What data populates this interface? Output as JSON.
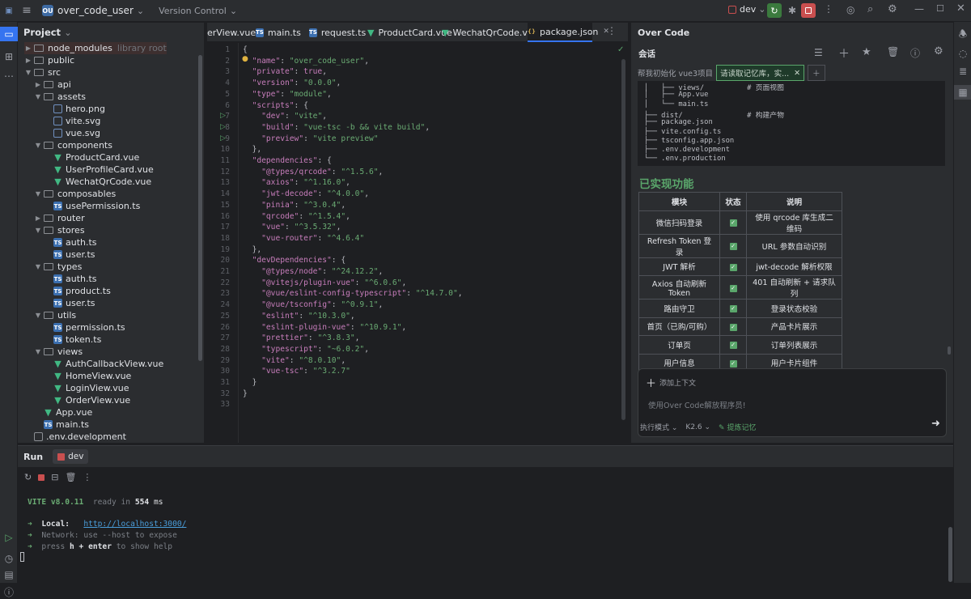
{
  "titlebar": {
    "project_badge": "OU",
    "project_name": "over_code_user",
    "vcs": "Version Control",
    "run_config": "dev"
  },
  "project": {
    "title": "Project",
    "tree": [
      {
        "label": "node_modules",
        "note": "library root",
        "depth": 1,
        "kind": "folder",
        "open": false
      },
      {
        "label": "public",
        "depth": 1,
        "kind": "folder",
        "open": false
      },
      {
        "label": "src",
        "depth": 1,
        "kind": "folder",
        "open": true
      },
      {
        "label": "api",
        "depth": 2,
        "kind": "folder",
        "open": false
      },
      {
        "label": "assets",
        "depth": 2,
        "kind": "folder",
        "open": true
      },
      {
        "label": "hero.png",
        "depth": 3,
        "kind": "img"
      },
      {
        "label": "vite.svg",
        "depth": 3,
        "kind": "img"
      },
      {
        "label": "vue.svg",
        "depth": 3,
        "kind": "img"
      },
      {
        "label": "components",
        "depth": 2,
        "kind": "folder",
        "open": true
      },
      {
        "label": "ProductCard.vue",
        "depth": 3,
        "kind": "vue"
      },
      {
        "label": "UserProfileCard.vue",
        "depth": 3,
        "kind": "vue"
      },
      {
        "label": "WechatQrCode.vue",
        "depth": 3,
        "kind": "vue"
      },
      {
        "label": "composables",
        "depth": 2,
        "kind": "folder",
        "open": true
      },
      {
        "label": "usePermission.ts",
        "depth": 3,
        "kind": "ts"
      },
      {
        "label": "router",
        "depth": 2,
        "kind": "folder",
        "open": false
      },
      {
        "label": "stores",
        "depth": 2,
        "kind": "folder",
        "open": true
      },
      {
        "label": "auth.ts",
        "depth": 3,
        "kind": "ts"
      },
      {
        "label": "user.ts",
        "depth": 3,
        "kind": "ts"
      },
      {
        "label": "types",
        "depth": 2,
        "kind": "folder",
        "open": true
      },
      {
        "label": "auth.ts",
        "depth": 3,
        "kind": "ts"
      },
      {
        "label": "product.ts",
        "depth": 3,
        "kind": "ts"
      },
      {
        "label": "user.ts",
        "depth": 3,
        "kind": "ts"
      },
      {
        "label": "utils",
        "depth": 2,
        "kind": "folder",
        "open": true
      },
      {
        "label": "permission.ts",
        "depth": 3,
        "kind": "ts"
      },
      {
        "label": "token.ts",
        "depth": 3,
        "kind": "ts"
      },
      {
        "label": "views",
        "depth": 2,
        "kind": "folder",
        "open": true
      },
      {
        "label": "AuthCallbackView.vue",
        "depth": 3,
        "kind": "vue"
      },
      {
        "label": "HomeView.vue",
        "depth": 3,
        "kind": "vue"
      },
      {
        "label": "LoginView.vue",
        "depth": 3,
        "kind": "vue"
      },
      {
        "label": "OrderView.vue",
        "depth": 3,
        "kind": "vue"
      },
      {
        "label": "App.vue",
        "depth": 2,
        "kind": "vue"
      },
      {
        "label": "main.ts",
        "depth": 2,
        "kind": "ts"
      },
      {
        "label": ".env.development",
        "depth": 1,
        "kind": "file"
      }
    ]
  },
  "editor": {
    "tabs": [
      {
        "label": "erView.vue",
        "kind": "vue"
      },
      {
        "label": "main.ts",
        "kind": "ts"
      },
      {
        "label": "request.ts",
        "kind": "ts"
      },
      {
        "label": "ProductCard.vue",
        "kind": "vue"
      },
      {
        "label": "WechatQrCode.vue",
        "kind": "vue"
      },
      {
        "label": "package.json",
        "kind": "json",
        "active": true
      }
    ],
    "lines": [
      [
        [
          "p",
          "{"
        ]
      ],
      [
        [
          "k",
          "\"name\""
        ],
        [
          "p",
          ": "
        ],
        [
          "s",
          "\"over_code_user\""
        ],
        [
          "p",
          ","
        ]
      ],
      [
        [
          "k",
          "\"private\""
        ],
        [
          "p",
          ": "
        ],
        [
          "k",
          "true"
        ],
        [
          "p",
          ","
        ]
      ],
      [
        [
          "k",
          "\"version\""
        ],
        [
          "p",
          ": "
        ],
        [
          "s",
          "\"0.0.0\""
        ],
        [
          "p",
          ","
        ]
      ],
      [
        [
          "k",
          "\"type\""
        ],
        [
          "p",
          ": "
        ],
        [
          "s",
          "\"module\""
        ],
        [
          "p",
          ","
        ]
      ],
      [
        [
          "k",
          "\"scripts\""
        ],
        [
          "p",
          ": {"
        ]
      ],
      [
        [
          "p",
          "  "
        ],
        [
          "k",
          "\"dev\""
        ],
        [
          "p",
          ": "
        ],
        [
          "s",
          "\"vite\""
        ],
        [
          "p",
          ","
        ]
      ],
      [
        [
          "p",
          "  "
        ],
        [
          "k",
          "\"build\""
        ],
        [
          "p",
          ": "
        ],
        [
          "s",
          "\"vue-tsc -b && vite build\""
        ],
        [
          "p",
          ","
        ]
      ],
      [
        [
          "p",
          "  "
        ],
        [
          "k",
          "\"preview\""
        ],
        [
          "p",
          ": "
        ],
        [
          "s",
          "\"vite preview\""
        ]
      ],
      [
        [
          "p",
          "},"
        ]
      ],
      [
        [
          "k",
          "\"dependencies\""
        ],
        [
          "p",
          ": {"
        ]
      ],
      [
        [
          "p",
          "  "
        ],
        [
          "k",
          "\"@types/qrcode\""
        ],
        [
          "p",
          ": "
        ],
        [
          "s",
          "\"^1.5.6\""
        ],
        [
          "p",
          ","
        ]
      ],
      [
        [
          "p",
          "  "
        ],
        [
          "k",
          "\"axios\""
        ],
        [
          "p",
          ": "
        ],
        [
          "s",
          "\"^1.16.0\""
        ],
        [
          "p",
          ","
        ]
      ],
      [
        [
          "p",
          "  "
        ],
        [
          "k",
          "\"jwt-decode\""
        ],
        [
          "p",
          ": "
        ],
        [
          "s",
          "\"^4.0.0\""
        ],
        [
          "p",
          ","
        ]
      ],
      [
        [
          "p",
          "  "
        ],
        [
          "k",
          "\"pinia\""
        ],
        [
          "p",
          ": "
        ],
        [
          "s",
          "\"^3.0.4\""
        ],
        [
          "p",
          ","
        ]
      ],
      [
        [
          "p",
          "  "
        ],
        [
          "k",
          "\"qrcode\""
        ],
        [
          "p",
          ": "
        ],
        [
          "s",
          "\"^1.5.4\""
        ],
        [
          "p",
          ","
        ]
      ],
      [
        [
          "p",
          "  "
        ],
        [
          "k",
          "\"vue\""
        ],
        [
          "p",
          ": "
        ],
        [
          "s",
          "\"^3.5.32\""
        ],
        [
          "p",
          ","
        ]
      ],
      [
        [
          "p",
          "  "
        ],
        [
          "k",
          "\"vue-router\""
        ],
        [
          "p",
          ": "
        ],
        [
          "s",
          "\"^4.6.4\""
        ]
      ],
      [
        [
          "p",
          "},"
        ]
      ],
      [
        [
          "k",
          "\"devDependencies\""
        ],
        [
          "p",
          ": {"
        ]
      ],
      [
        [
          "p",
          "  "
        ],
        [
          "k",
          "\"@types/node\""
        ],
        [
          "p",
          ": "
        ],
        [
          "s",
          "\"^24.12.2\""
        ],
        [
          "p",
          ","
        ]
      ],
      [
        [
          "p",
          "  "
        ],
        [
          "k",
          "\"@vitejs/plugin-vue\""
        ],
        [
          "p",
          ": "
        ],
        [
          "s",
          "\"^6.0.6\""
        ],
        [
          "p",
          ","
        ]
      ],
      [
        [
          "p",
          "  "
        ],
        [
          "k",
          "\"@vue/eslint-config-typescript\""
        ],
        [
          "p",
          ": "
        ],
        [
          "s",
          "\"^14.7.0\""
        ],
        [
          "p",
          ","
        ]
      ],
      [
        [
          "p",
          "  "
        ],
        [
          "k",
          "\"@vue/tsconfig\""
        ],
        [
          "p",
          ": "
        ],
        [
          "s",
          "\"^0.9.1\""
        ],
        [
          "p",
          ","
        ]
      ],
      [
        [
          "p",
          "  "
        ],
        [
          "k",
          "\"eslint\""
        ],
        [
          "p",
          ": "
        ],
        [
          "s",
          "\"^10.3.0\""
        ],
        [
          "p",
          ","
        ]
      ],
      [
        [
          "p",
          "  "
        ],
        [
          "k",
          "\"eslint-plugin-vue\""
        ],
        [
          "p",
          ": "
        ],
        [
          "s",
          "\"^10.9.1\""
        ],
        [
          "p",
          ","
        ]
      ],
      [
        [
          "p",
          "  "
        ],
        [
          "k",
          "\"prettier\""
        ],
        [
          "p",
          ": "
        ],
        [
          "s",
          "\"^3.8.3\""
        ],
        [
          "p",
          ","
        ]
      ],
      [
        [
          "p",
          "  "
        ],
        [
          "k",
          "\"typescript\""
        ],
        [
          "p",
          ": "
        ],
        [
          "s",
          "\"~6.0.2\""
        ],
        [
          "p",
          ","
        ]
      ],
      [
        [
          "p",
          "  "
        ],
        [
          "k",
          "\"vite\""
        ],
        [
          "p",
          ": "
        ],
        [
          "s",
          "\"^8.0.10\""
        ],
        [
          "p",
          ","
        ]
      ],
      [
        [
          "p",
          "  "
        ],
        [
          "k",
          "\"vue-tsc\""
        ],
        [
          "p",
          ": "
        ],
        [
          "s",
          "\"^3.2.7\""
        ]
      ],
      [
        [
          "p",
          "}"
        ]
      ],
      [
        [
          "p",
          "}"
        ]
      ],
      [
        [
          "p",
          ""
        ]
      ]
    ]
  },
  "overcode": {
    "title": "Over Code",
    "subtitle": "会话",
    "chat_tabs": [
      "帮我初始化 vue3项目",
      "请读取记忆库，实..."
    ],
    "tree_lines": [
      "│   ├── views/          # 页面视图",
      "│   ├── App.vue",
      "│   └── main.ts",
      "├── dist/               # 构建产物",
      "├── package.json",
      "├── vite.config.ts",
      "├── tsconfig.app.json",
      "├── .env.development",
      "└── .env.production"
    ],
    "section_title": "已实现功能",
    "table_headers": [
      "模块",
      "状态",
      "说明"
    ],
    "table_rows": [
      [
        "微信扫码登录",
        "使用 qrcode 库生成二维码"
      ],
      [
        "Refresh Token 登录",
        "URL 参数自动识别"
      ],
      [
        "JWT 解析",
        "jwt-decode 解析权限"
      ],
      [
        "Axios 自动刷新 Token",
        "401 自动刷新 + 请求队列"
      ],
      [
        "路由守卫",
        "登录状态校验"
      ],
      [
        "首页（已购/可购）",
        "产品卡片展示"
      ],
      [
        "订单页",
        "订单列表展示"
      ],
      [
        "用户信息",
        "用户卡片组件"
      ]
    ],
    "add_context": "添加上下文",
    "input_placeholder": "使用Over Code解放程序员!",
    "mode": "执行模式",
    "model": "K2.6",
    "memory": "提炼记忆"
  },
  "run": {
    "title": "Run",
    "config_tab": "dev",
    "terminal": {
      "vite_label": "VITE v8.0.11",
      "ready_text": "ready in",
      "ready_ms": "554",
      "ms_unit": "ms",
      "local_label": "Local:",
      "local_url": "http://localhost:3000/",
      "network_line": "Network: use --host to expose",
      "help_prefix": "press ",
      "help_key": "h + enter",
      "help_suffix": " to show help"
    }
  }
}
